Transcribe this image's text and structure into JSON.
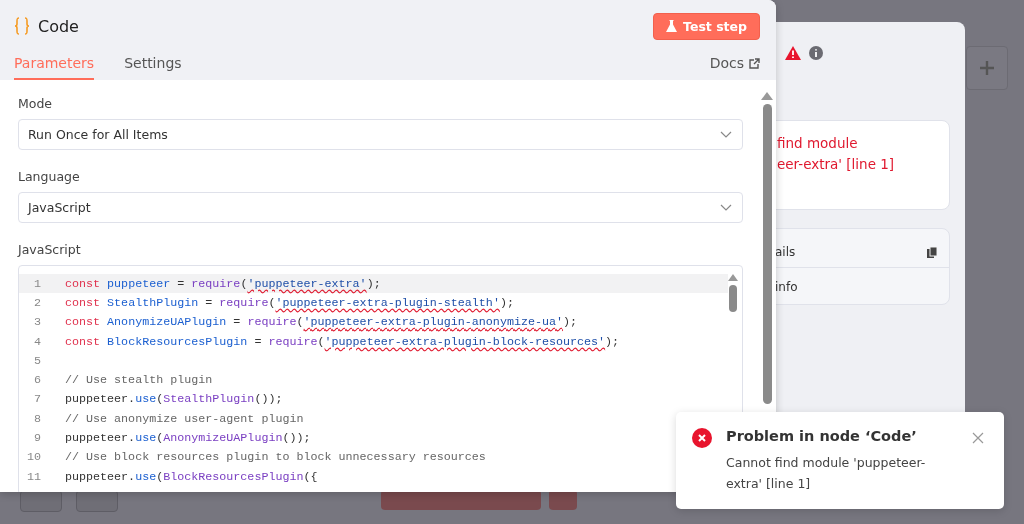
{
  "background_panel": {
    "error_lines": [
      "find module",
      "eer-extra' [line 1]"
    ],
    "details_title": "ails",
    "details_row": "info"
  },
  "modal": {
    "title": "Code",
    "test_button": "Test step",
    "tabs": [
      {
        "label": "Parameters",
        "selected": true
      },
      {
        "label": "Settings",
        "selected": false
      }
    ],
    "docs_link": "Docs",
    "fields": [
      {
        "label": "Mode",
        "value": "Run Once for All Items"
      },
      {
        "label": "Language",
        "value": "JavaScript"
      }
    ],
    "editor": {
      "label": "JavaScript",
      "lines": [
        {
          "number": "1",
          "active": true,
          "tokens": [
            {
              "kind": "keyword",
              "text": "const "
            },
            {
              "kind": "variable",
              "text": "puppeteer"
            },
            {
              "kind": "plain",
              "text": " = "
            },
            {
              "kind": "function",
              "text": "require"
            },
            {
              "kind": "plain",
              "text": "("
            },
            {
              "kind": "flagged-string",
              "text": "'puppeteer-extra'"
            },
            {
              "kind": "plain",
              "text": ");"
            }
          ]
        },
        {
          "number": "2",
          "active": false,
          "tokens": [
            {
              "kind": "keyword",
              "text": "const "
            },
            {
              "kind": "variable",
              "text": "StealthPlugin"
            },
            {
              "kind": "plain",
              "text": " = "
            },
            {
              "kind": "function",
              "text": "require"
            },
            {
              "kind": "plain",
              "text": "("
            },
            {
              "kind": "flagged-string",
              "text": "'puppeteer-extra-plugin-stealth'"
            },
            {
              "kind": "plain",
              "text": ");"
            }
          ]
        },
        {
          "number": "3",
          "active": false,
          "tokens": [
            {
              "kind": "keyword",
              "text": "const "
            },
            {
              "kind": "variable",
              "text": "AnonymizeUAPlugin"
            },
            {
              "kind": "plain",
              "text": " = "
            },
            {
              "kind": "function",
              "text": "require"
            },
            {
              "kind": "plain",
              "text": "("
            },
            {
              "kind": "flagged-string",
              "text": "'puppeteer-extra-plugin-anonymize-ua'"
            },
            {
              "kind": "plain",
              "text": ");"
            }
          ]
        },
        {
          "number": "4",
          "active": false,
          "tokens": [
            {
              "kind": "keyword",
              "text": "const "
            },
            {
              "kind": "variable",
              "text": "BlockResourcesPlugin"
            },
            {
              "kind": "plain",
              "text": " = "
            },
            {
              "kind": "function",
              "text": "require"
            },
            {
              "kind": "plain",
              "text": "("
            },
            {
              "kind": "flagged-string",
              "text": "'puppeteer-extra-plugin-block-resources'"
            },
            {
              "kind": "plain",
              "text": ");"
            }
          ]
        },
        {
          "number": "5",
          "active": false
        },
        {
          "number": "6",
          "active": false,
          "tokens": [
            {
              "kind": "comment",
              "text": "// Use stealth plugin"
            }
          ]
        },
        {
          "number": "7",
          "active": false,
          "tokens": [
            {
              "kind": "plain",
              "text": "puppeteer."
            },
            {
              "kind": "method",
              "text": "use"
            },
            {
              "kind": "plain",
              "text": "("
            },
            {
              "kind": "function",
              "text": "StealthPlugin"
            },
            {
              "kind": "plain",
              "text": "());"
            }
          ]
        },
        {
          "number": "8",
          "active": false,
          "tokens": [
            {
              "kind": "comment",
              "text": "// Use anonymize user-agent plugin"
            }
          ]
        },
        {
          "number": "9",
          "active": false,
          "tokens": [
            {
              "kind": "plain",
              "text": "puppeteer."
            },
            {
              "kind": "method",
              "text": "use"
            },
            {
              "kind": "plain",
              "text": "("
            },
            {
              "kind": "function",
              "text": "AnonymizeUAPlugin"
            },
            {
              "kind": "plain",
              "text": "());"
            }
          ]
        },
        {
          "number": "10",
          "active": false,
          "tokens": [
            {
              "kind": "comment",
              "text": "// Use block resources plugin to block unnecessary resources"
            }
          ]
        },
        {
          "number": "11",
          "active": false,
          "tokens": [
            {
              "kind": "plain",
              "text": "puppeteer."
            },
            {
              "kind": "method",
              "text": "use"
            },
            {
              "kind": "plain",
              "text": "("
            },
            {
              "kind": "function",
              "text": "BlockResourcesPlugin"
            },
            {
              "kind": "plain",
              "text": "({"
            }
          ]
        }
      ]
    }
  },
  "toast": {
    "title": "Problem in node ‘Code’",
    "message": "Cannot find module 'puppeteer-extra' [line 1]"
  }
}
